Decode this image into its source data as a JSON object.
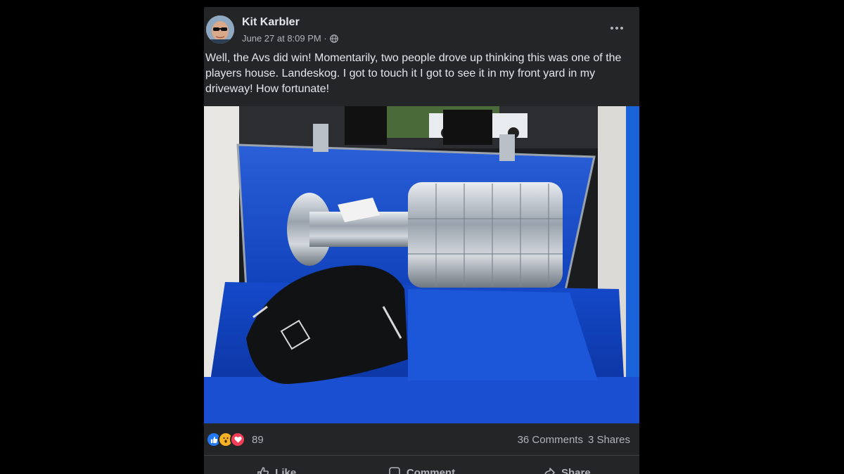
{
  "post": {
    "author": "Kit Karbler",
    "timestamp": "June 27 at 8:09 PM ·",
    "privacy_icon": "globe-icon",
    "more_icon": "more-options-icon",
    "text": "Well, the Avs did win! Momentarily, two people drove up thinking this was one of the players house. Landeskog. I got to touch it I got to see it in my front yard in my driveway! How fortunate!",
    "photo_icon": "photo-trophy-case"
  },
  "reactions": {
    "icons": [
      "like-reaction-icon",
      "wow-reaction-icon",
      "love-reaction-icon"
    ],
    "count": "89"
  },
  "stats": {
    "comments": "36 Comments",
    "shares": "3 Shares"
  },
  "actions": {
    "like": "Like",
    "comment": "Comment",
    "share": "Share"
  },
  "colors": {
    "card_bg": "#242526",
    "page_bg": "#000000",
    "text_primary": "#e4e6eb",
    "text_secondary": "#b0b3b8",
    "like_blue": "#2078f4",
    "love_red": "#f33e58",
    "wow_yellow": "#f7b125",
    "velvet_blue": "#0d3fb8"
  }
}
